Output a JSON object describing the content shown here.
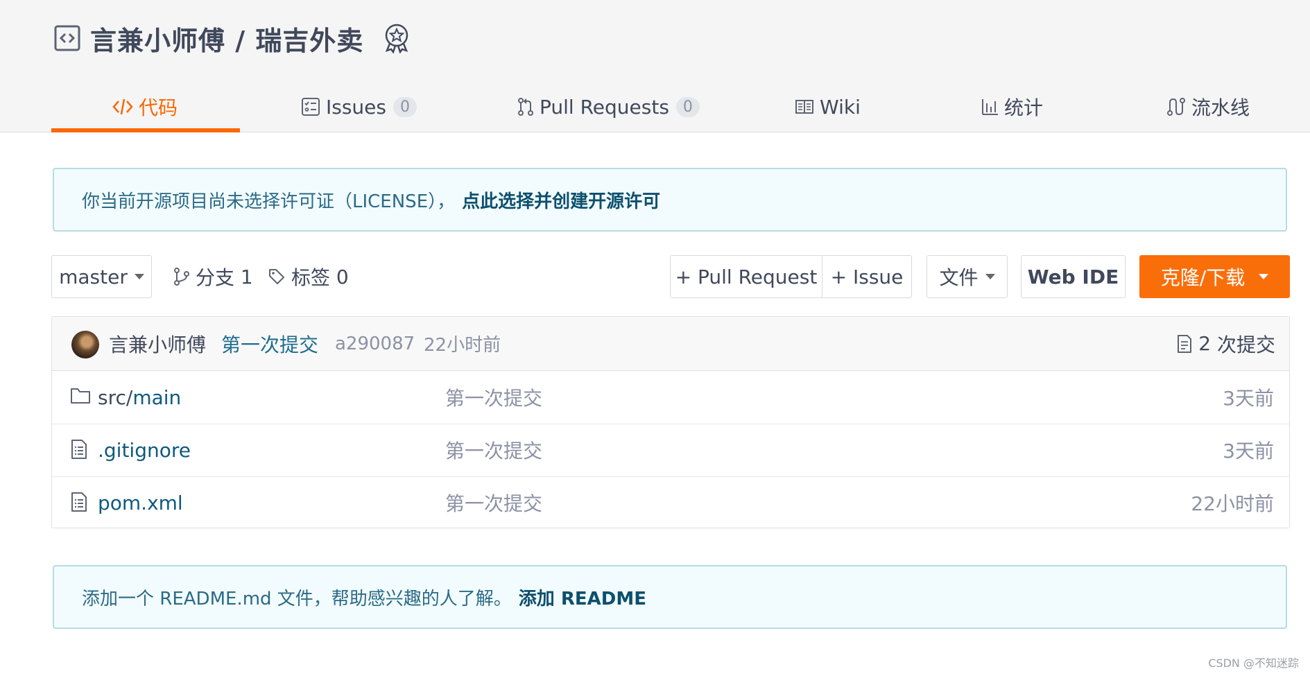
{
  "repo": {
    "owner": "言兼小师傅",
    "separator": " / ",
    "name": "瑞吉外卖"
  },
  "tabs": [
    {
      "label": "代码",
      "icon": "code-icon",
      "active": true
    },
    {
      "label": "Issues",
      "count": "0",
      "icon": "issues-icon"
    },
    {
      "label": "Pull Requests",
      "count": "0",
      "icon": "pull-request-icon"
    },
    {
      "label": "Wiki",
      "icon": "book-icon"
    },
    {
      "label": "统计",
      "icon": "bar-chart-icon"
    },
    {
      "label": "流水线",
      "icon": "pipeline-icon"
    }
  ],
  "license_notice": {
    "text": "你当前开源项目尚未选择许可证（LICENSE），",
    "link": "点此选择并创建开源许可"
  },
  "toolbar": {
    "branch": "master",
    "branches_label": "分支",
    "branches_count": "1",
    "tags_label": "标签",
    "tags_count": "0",
    "pull_request_button": "+ Pull Request",
    "issue_button": "+ Issue",
    "file_button": "文件",
    "web_ide_button": "Web IDE",
    "clone_button": "克隆/下载"
  },
  "last_commit": {
    "author": "言兼小师傅",
    "message": "第一次提交",
    "hash": "a290087",
    "time": "22小时前",
    "commits_count": "2",
    "commits_label": "次提交"
  },
  "files": [
    {
      "prefix": "src/",
      "name": "main",
      "type": "folder",
      "message": "第一次提交",
      "time": "3天前"
    },
    {
      "prefix": "",
      "name": ".gitignore",
      "type": "file",
      "message": "第一次提交",
      "time": "3天前"
    },
    {
      "prefix": "",
      "name": "pom.xml",
      "type": "file",
      "message": "第一次提交",
      "time": "22小时前"
    }
  ],
  "readme_notice": {
    "text": "添加一个 README.md 文件，帮助感兴趣的人了解。",
    "link": "添加 README"
  },
  "watermark": "CSDN @不知迷踪",
  "colors": {
    "accent": "#fa6800",
    "link": "#0d5a7c",
    "notice_bg": "#f2fcfe"
  }
}
